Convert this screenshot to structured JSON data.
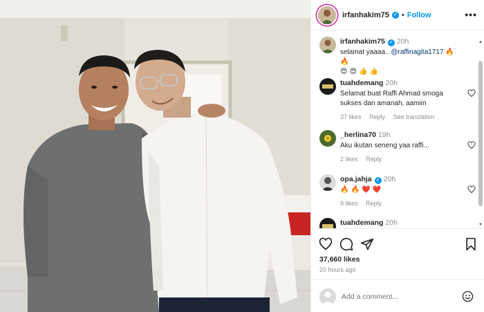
{
  "post": {
    "username": "irfanhakim75",
    "follow_label": "Follow",
    "more_label": "•••",
    "caption": {
      "username": "irfanhakim75",
      "time": "20h",
      "text_main": "selamat yaaaa.. ",
      "mention": "@raffinagita1717",
      "text_emojis_1": "🔥 🔥",
      "text_emojis_2": "😍 😍 👍 👍"
    },
    "comments": [
      {
        "username": "tuahdemang",
        "time": "20h",
        "text": "Selamat buat Raffi Ahmad smoga sukses dan amanah, aamiin",
        "likes": "37 likes",
        "reply": "Reply",
        "translation": "See translation"
      },
      {
        "username": "_herlina70",
        "time": "19h",
        "text": "Aku ikutan seneng yaa raffi...",
        "likes": "2 likes",
        "reply": "Reply"
      },
      {
        "username": "opa.jahja",
        "time": "20h",
        "text": "🔥 🔥 ❤️ ❤️",
        "likes": "9 likes",
        "reply": "Reply"
      },
      {
        "username": "tuahdemang",
        "time": "20h"
      }
    ],
    "likes_count": "37,660 likes",
    "posted_ago": "20 hours ago",
    "add_comment_placeholder": "Add a comment..."
  },
  "icons": {
    "header_avatar": "profile-avatar-icon",
    "verified": "verified-badge-icon",
    "like": "heart-icon",
    "comment": "comment-icon",
    "share": "share-icon",
    "save": "bookmark-icon",
    "emoji": "emoji-icon"
  },
  "colors": {
    "accent": "#0095f6",
    "text": "#262626",
    "muted": "#8e8e8e",
    "divider": "#efefef"
  }
}
